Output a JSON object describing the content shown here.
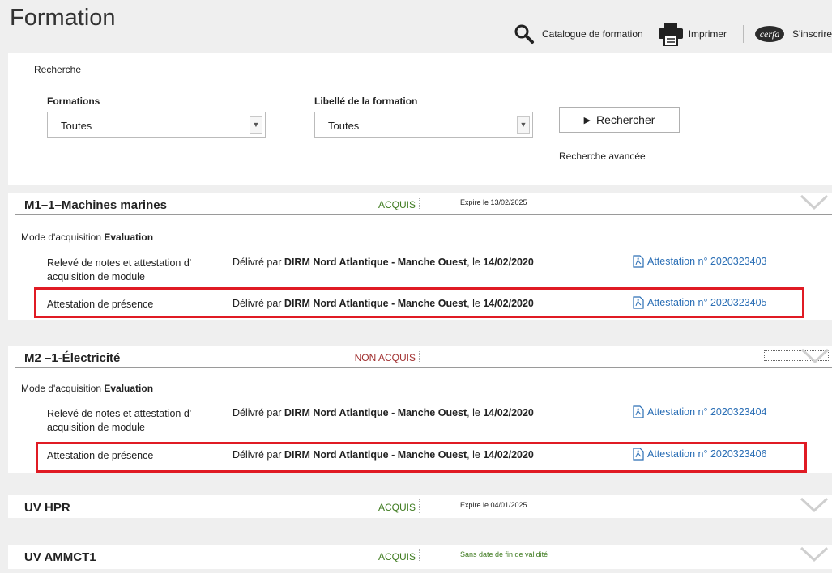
{
  "header": {
    "title": "Formation",
    "catalogue_label": "Catalogue de formation",
    "print_label": "Imprimer",
    "cerfa_label": "cerfa",
    "signup_label": "S'inscrire"
  },
  "search": {
    "title": "Recherche",
    "formations_label": "Formations",
    "formations_value": "Toutes",
    "libelle_label": "Libellé de la formation",
    "libelle_value": "Toutes",
    "search_button": "Rechercher",
    "advanced_link": "Recherche avancée"
  },
  "modules": [
    {
      "title": "M1–1–Machines marines",
      "status": "ACQUIS",
      "expire": "Expire le 13/02/2025",
      "mode_prefix": "Mode d'acquisition ",
      "mode_value": "Evaluation",
      "rows": [
        {
          "label": "Relevé de notes et attestation d' acquisition de module",
          "prefix": "Délivré par ",
          "issuer": "DIRM Nord Atlantique - Manche Ouest",
          "mid": ", le ",
          "date": "14/02/2020",
          "link": "Attestation n° 2020323403"
        },
        {
          "label": "Attestation de présence",
          "prefix": "Délivré par ",
          "issuer": "DIRM Nord Atlantique - Manche Ouest",
          "mid": ", le ",
          "date": "14/02/2020",
          "link": "Attestation n° 2020323405"
        }
      ]
    },
    {
      "title": "M2 –1-Électricité",
      "status": "NON ACQUIS",
      "mode_prefix": "Mode d'acquisition ",
      "mode_value": "Evaluation",
      "rows": [
        {
          "label": "Relevé de notes et attestation d' acquisition de module",
          "prefix": "Délivré par ",
          "issuer": "DIRM Nord Atlantique - Manche Ouest",
          "mid": ", le ",
          "date": "14/02/2020",
          "link": "Attestation n° 2020323404"
        },
        {
          "label": "Attestation de présence",
          "prefix": "Délivré par ",
          "issuer": "DIRM Nord Atlantique - Manche Ouest",
          "mid": ", le ",
          "date": "14/02/2020",
          "link": "Attestation n° 2020323406"
        }
      ]
    },
    {
      "title": "UV HPR",
      "status": "ACQUIS",
      "expire": "Expire le 04/01/2025"
    },
    {
      "title": "UV AMMCT1",
      "status": "ACQUIS",
      "expire": "Sans date de fin de validité"
    }
  ],
  "colors": {
    "status_ok": "#3d7a1e",
    "status_ko": "#a13030",
    "link": "#2a6eb5",
    "highlight": "#e01b24"
  }
}
